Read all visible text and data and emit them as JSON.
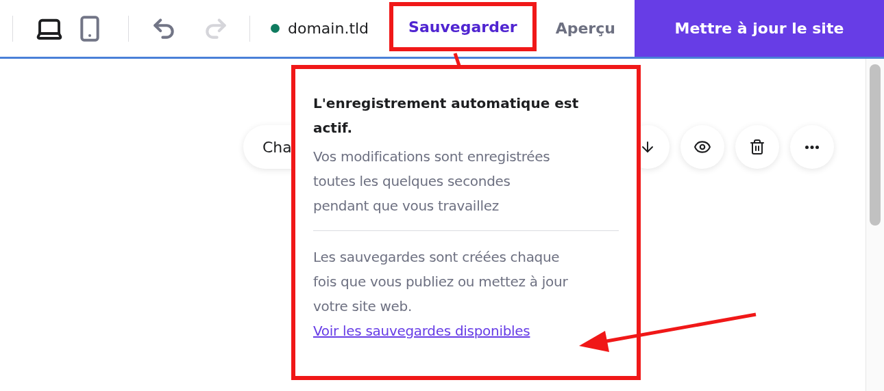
{
  "toolbar": {
    "devices": [
      {
        "kind": "desktop",
        "selected": true
      },
      {
        "kind": "mobile",
        "selected": false
      }
    ],
    "undo": {
      "disabled": false
    },
    "redo": {
      "disabled": true
    },
    "domain": "domain.tld",
    "save_label": "Sauvegarder",
    "preview_label": "Aperçu",
    "update_label": "Mettre à jour le site"
  },
  "block_toolbar": {
    "label": "Cha"
  },
  "popover": {
    "title": "L'enregistrement automatique est actif.",
    "autosave_text": "Vos modifications sont enregistrées toutes les quelques secondes pendant que vous travaillez",
    "backup_text": "Les sauvegardes sont créées chaque fois que vous publiez ou mettez à jour votre site web.",
    "link": "Voir les sauvegardes disponibles"
  }
}
